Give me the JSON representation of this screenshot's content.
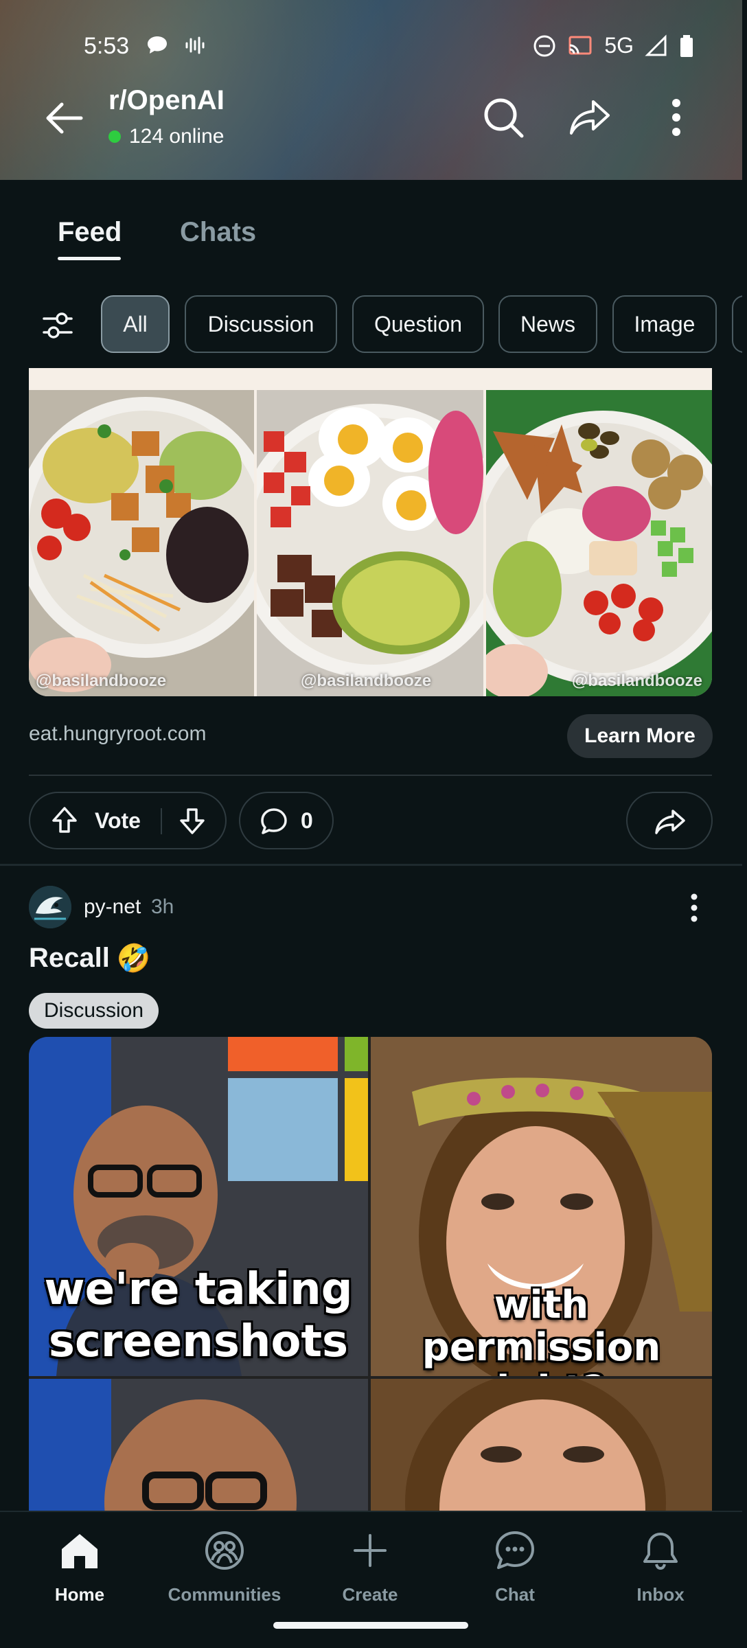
{
  "status_bar": {
    "time": "5:53",
    "network": "5G"
  },
  "header": {
    "subreddit": "r/OpenAI",
    "online_count": "124 online",
    "icons": [
      "back-arrow-icon",
      "search-icon",
      "share-icon",
      "more-vertical-icon"
    ]
  },
  "tabs": [
    {
      "label": "Feed",
      "active": true
    },
    {
      "label": "Chats",
      "active": false
    }
  ],
  "filters": {
    "icon": "filter-sliders-icon",
    "chips": [
      {
        "label": "All",
        "active": true
      },
      {
        "label": "Discussion",
        "active": false
      },
      {
        "label": "Question",
        "active": false
      },
      {
        "label": "News",
        "active": false
      },
      {
        "label": "Image",
        "active": false
      }
    ]
  },
  "ad_post": {
    "watermarks": [
      "@basilandbooze",
      "@basilandbooze",
      "@basilandbooze"
    ],
    "domain": "eat.hungryroot.com",
    "cta": "Learn More",
    "vote_label": "Vote",
    "comment_count": "0"
  },
  "post": {
    "author": "py-net",
    "age": "3h",
    "title": "Recall",
    "title_emoji": "🤣",
    "flair": "Discussion",
    "meme": {
      "top_left": "we're taking screenshots",
      "top_right": "with permission right?"
    }
  },
  "bottom_nav": [
    {
      "label": "Home",
      "icon": "home-icon",
      "active": true
    },
    {
      "label": "Communities",
      "icon": "communities-icon",
      "active": false
    },
    {
      "label": "Create",
      "icon": "plus-icon",
      "active": false
    },
    {
      "label": "Chat",
      "icon": "chat-icon",
      "active": false
    },
    {
      "label": "Inbox",
      "icon": "bell-icon",
      "active": false
    }
  ],
  "colors": {
    "background": "#0b1416",
    "online": "#2ecc40",
    "chip_active": "#3b4b52",
    "muted_text": "#8a9ba3"
  }
}
